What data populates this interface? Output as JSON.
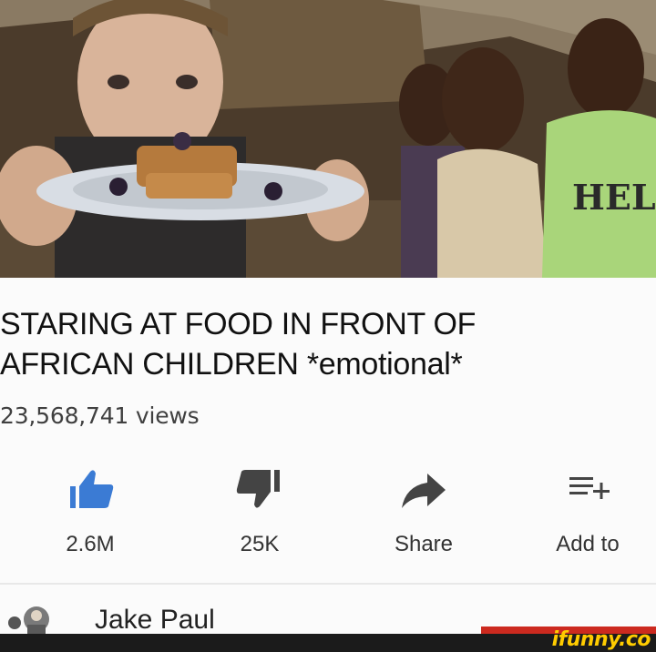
{
  "video": {
    "title_line1": "STARING AT FOOD IN FRONT OF",
    "title_line2": "AFRICAN CHILDREN *emotional*",
    "views": "23,568,741 views",
    "thumbnail_text": "HEL"
  },
  "actions": {
    "like": {
      "label": "2.6M",
      "icon": "thumbs-up-icon",
      "color": "#3b7bd4"
    },
    "dislike": {
      "label": "25K",
      "icon": "thumbs-down-icon",
      "color": "#444444"
    },
    "share": {
      "label": "Share",
      "icon": "share-arrow-icon",
      "color": "#444444"
    },
    "add": {
      "label": "Add to",
      "icon": "add-to-playlist-icon",
      "color": "#444444"
    }
  },
  "channel": {
    "name": "Jake Paul"
  },
  "watermark": {
    "text": "ifunny.co",
    "color": "#ffcc00"
  }
}
